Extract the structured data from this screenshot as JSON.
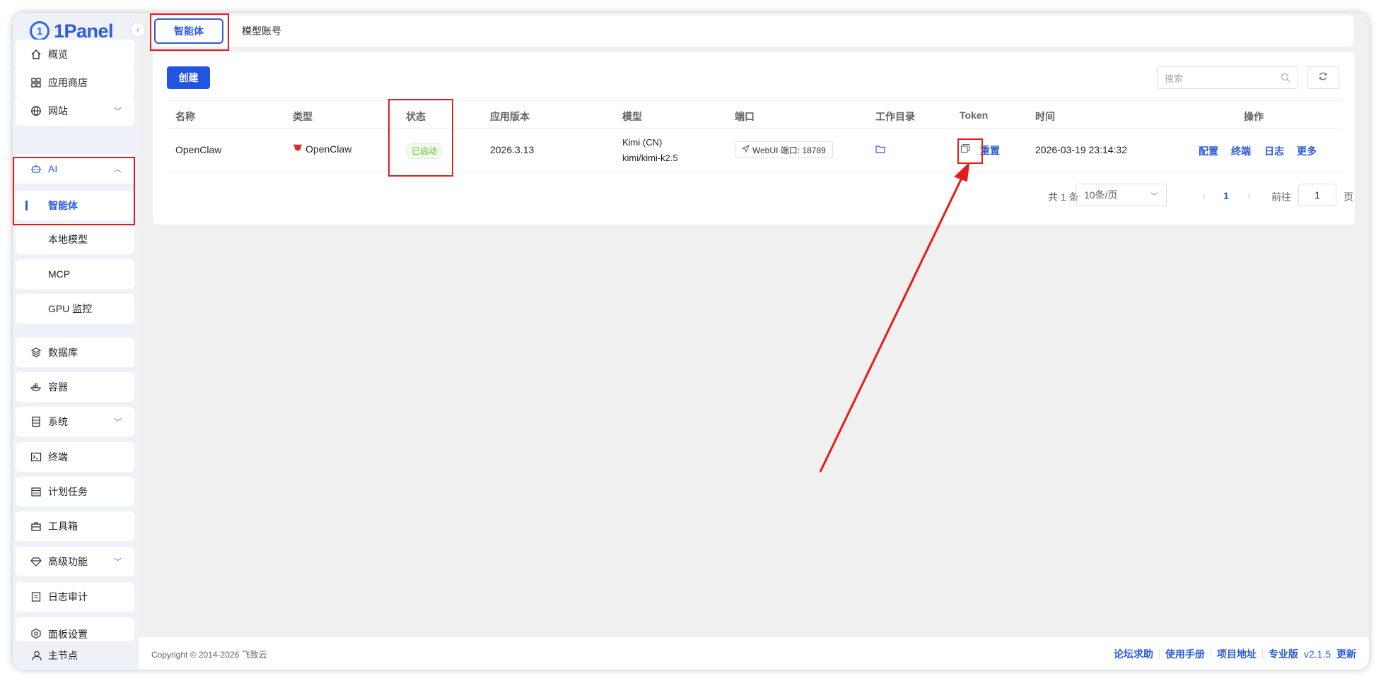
{
  "app": {
    "logo_text": "1Panel",
    "logo_mark": "1"
  },
  "sidebar": {
    "items": [
      {
        "label": "概览",
        "icon": "home-icon"
      },
      {
        "label": "应用商店",
        "icon": "apps-icon"
      },
      {
        "label": "网站",
        "icon": "globe-icon"
      },
      {
        "label": "AI",
        "icon": "robot-icon"
      },
      {
        "label": "智能体"
      },
      {
        "label": "本地模型"
      },
      {
        "label": "MCP"
      },
      {
        "label": "GPU 监控"
      },
      {
        "label": "数据库",
        "icon": "layers-icon"
      },
      {
        "label": "容器",
        "icon": "container-icon"
      },
      {
        "label": "系统",
        "icon": "server-icon"
      },
      {
        "label": "终端",
        "icon": "terminal-icon"
      },
      {
        "label": "计划任务",
        "icon": "calendar-icon"
      },
      {
        "label": "工具箱",
        "icon": "toolbox-icon"
      },
      {
        "label": "高级功能",
        "icon": "diamond-icon"
      },
      {
        "label": "日志审计",
        "icon": "log-icon"
      },
      {
        "label": "面板设置",
        "icon": "settings-icon"
      }
    ],
    "node_label": "主节点"
  },
  "tabs": [
    {
      "label": "智能体",
      "active": true
    },
    {
      "label": "模型账号",
      "active": false
    }
  ],
  "toolbar": {
    "create_label": "创建",
    "search_placeholder": "搜索"
  },
  "table": {
    "columns": [
      "名称",
      "类型",
      "状态",
      "应用版本",
      "模型",
      "端口",
      "工作目录",
      "Token",
      "时间",
      "操作"
    ],
    "rows": [
      {
        "name": "OpenClaw",
        "type": "OpenClaw",
        "status": "已启动",
        "version": "2026.3.13",
        "model_line1": "Kimi (CN)",
        "model_line2": "kimi/kimi-k2.5",
        "port": "WebUI 端口: 18789",
        "token_reset": "重置",
        "time": "2026-03-19 23:14:32",
        "actions": [
          "配置",
          "终端",
          "日志",
          "更多"
        ]
      }
    ]
  },
  "pagination": {
    "total": "共 1 条",
    "page_size": "10条/页",
    "current_page": "1",
    "goto_label": "前往",
    "goto_value": "1",
    "page_unit": "页"
  },
  "footer": {
    "copyright": "Copyright © 2014-2026 飞致云",
    "links": [
      "论坛求助",
      "使用手册",
      "项目地址",
      "专业版"
    ],
    "version": "v2.1.5",
    "update": "更新"
  },
  "colors": {
    "accent": "#2c5dd6",
    "annotation": "#e51c1c",
    "status_green": "#67c23a"
  }
}
